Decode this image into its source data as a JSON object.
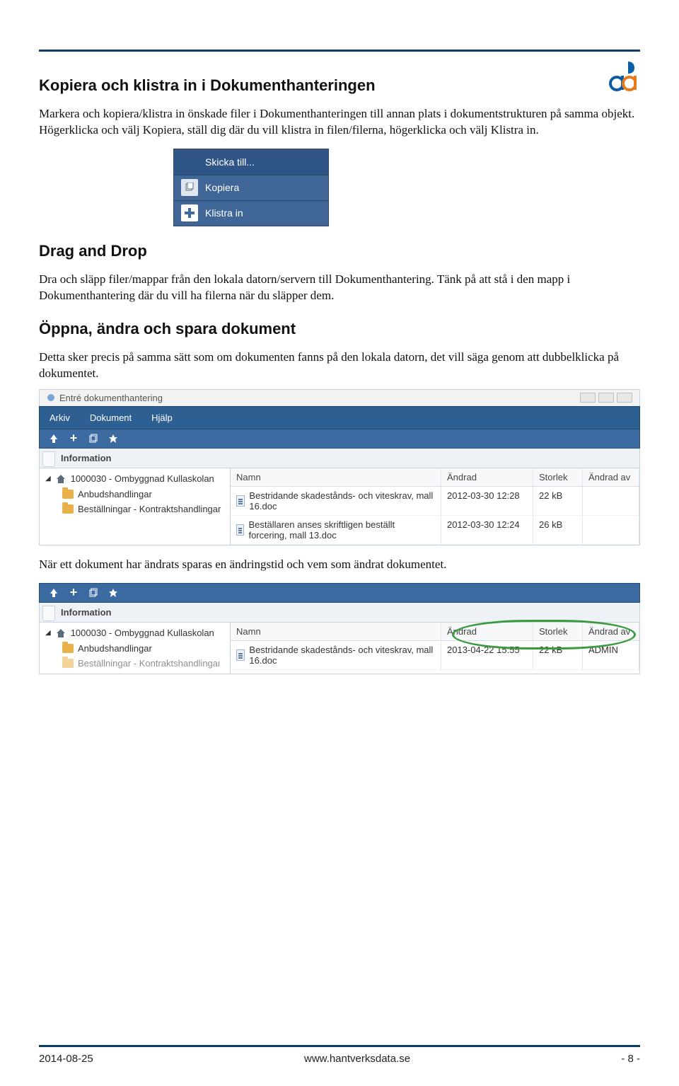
{
  "headings": {
    "h1": "Kopiera och klistra in i Dokumenthanteringen",
    "h2": "Drag and Drop",
    "h3": "Öppna, ändra och spara dokument"
  },
  "paragraphs": {
    "p1": "Markera och kopiera/klistra in önskade filer i Dokumenthanteringen till annan plats i dokumentstrukturen på samma objekt. Högerklicka och välj Kopiera, ställ dig där du vill klistra in filen/filerna, högerklicka och välj Klistra in.",
    "p2": "Dra och släpp filer/mappar från den lokala datorn/servern till Dokumenthantering. Tänk på att stå i den mapp i Dokumenthantering där du vill ha filerna när du släpper dem.",
    "p3": "Detta sker precis på samma sätt som om dokumenten fanns på den lokala datorn, det vill säga genom att dubbelklicka på dokumentet.",
    "p4": "När ett dokument har ändrats sparas en ändringstid och vem som ändrat dokumentet."
  },
  "context_menu": {
    "items": [
      {
        "label": "Skicka till...",
        "icon": "none"
      },
      {
        "label": "Kopiera",
        "icon": "copy"
      },
      {
        "label": "Klistra in",
        "icon": "plus"
      }
    ]
  },
  "screenshot1": {
    "window_title": "Entré dokumenthantering",
    "menu": [
      "Arkiv",
      "Dokument",
      "Hjälp"
    ],
    "info_label": "Information",
    "tree_root": "1000030 - Ombyggnad Kullaskolan",
    "tree_children": [
      "Anbudshandlingar",
      "Beställningar - Kontraktshandlingar"
    ],
    "columns": {
      "name": "Namn",
      "mod": "Ändrad",
      "size": "Storlek",
      "by": "Ändrad av"
    },
    "rows": [
      {
        "name": "Bestridande skadestånds- och viteskrav, mall 16.doc",
        "mod": "2012-03-30 12:28",
        "size": "22 kB",
        "by": ""
      },
      {
        "name": "Beställaren anses skriftligen beställt forcering, mall 13.doc",
        "mod": "2012-03-30 12:24",
        "size": "26 kB",
        "by": ""
      }
    ]
  },
  "screenshot2": {
    "info_label": "Information",
    "tree_root": "1000030 - Ombyggnad Kullaskolan",
    "tree_children": [
      "Anbudshandlingar",
      "Beställningar - Kontraktshandlingar"
    ],
    "columns": {
      "name": "Namn",
      "mod": "Ändrad",
      "size": "Storlek",
      "by": "Ändrad av"
    },
    "rows": [
      {
        "name": "Bestridande skadestånds- och viteskrav, mall 16.doc",
        "mod": "2013-04-22 15:55",
        "size": "22 kB",
        "by": "ADMIN"
      }
    ]
  },
  "footer": {
    "date": "2014-08-25",
    "url": "www.hantverksdata.se",
    "page": "- 8 -"
  }
}
